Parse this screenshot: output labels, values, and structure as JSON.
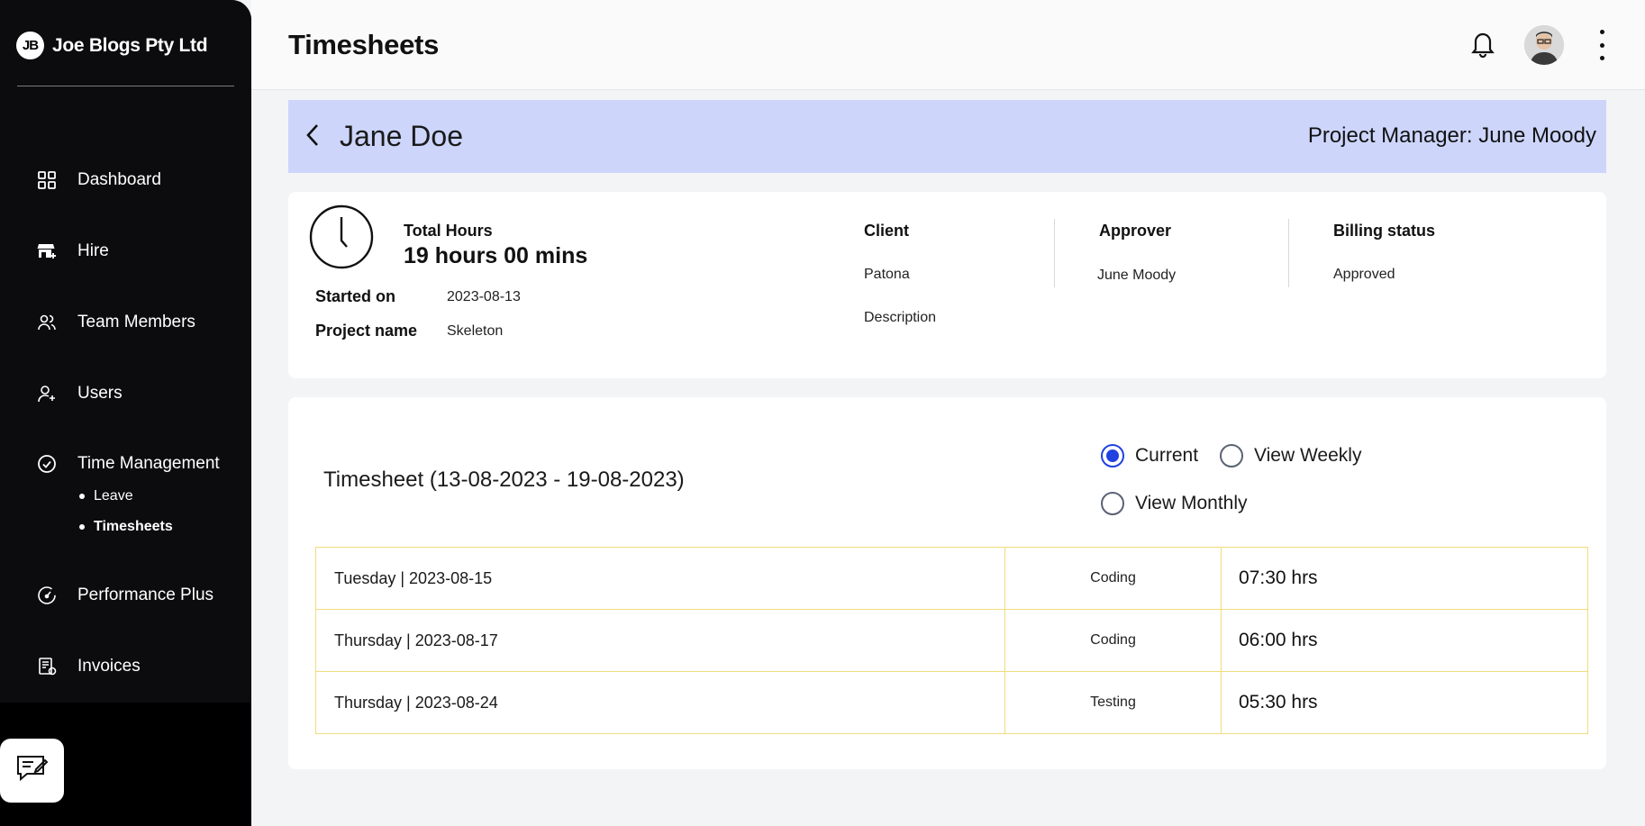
{
  "brand": {
    "logo": "JB",
    "name": "Joe Blogs Pty Ltd"
  },
  "sidebar": {
    "items": [
      {
        "label": "Dashboard",
        "icon": "grid-icon"
      },
      {
        "label": "Hire",
        "icon": "store-icon"
      },
      {
        "label": "Team Members",
        "icon": "team-icon"
      },
      {
        "label": "Users",
        "icon": "user-add-icon"
      },
      {
        "label": "Time Management",
        "icon": "check-circle-icon"
      },
      {
        "label": "Performance Plus",
        "icon": "gauge-icon"
      },
      {
        "label": "Invoices",
        "icon": "receipt-icon"
      }
    ],
    "subitems": [
      {
        "label": "Leave",
        "active": false
      },
      {
        "label": "Timesheets",
        "active": true
      }
    ]
  },
  "header": {
    "title": "Timesheets"
  },
  "employee": {
    "name": "Jane Doe",
    "pm_label": "Project Manager:",
    "pm_name": "June Moody"
  },
  "summary": {
    "total_hours_label": "Total Hours",
    "total_hours_value": "19 hours 00 mins",
    "started_label": "Started on",
    "started_value": "2023-08-13",
    "project_label": "Project name",
    "project_value": "Skeleton",
    "client_label": "Client",
    "client_value": "Patona",
    "description_label": "Description",
    "approver_label": "Approver",
    "approver_value": "June Moody",
    "billing_label": "Billing status",
    "billing_value": "Approved"
  },
  "timesheet": {
    "title": "Timesheet (13-08-2023 - 19-08-2023)",
    "view_options": [
      {
        "label": "Current",
        "checked": true
      },
      {
        "label": "View Weekly",
        "checked": false
      },
      {
        "label": "View Monthly",
        "checked": false
      }
    ],
    "rows": [
      {
        "day": "Tuesday | 2023-08-15",
        "task": "Coding",
        "hours": "07:30 hrs"
      },
      {
        "day": "Thursday | 2023-08-17",
        "task": "Coding",
        "hours": "06:00 hrs"
      },
      {
        "day": "Thursday | 2023-08-24",
        "task": "Testing",
        "hours": "05:30 hrs"
      }
    ]
  },
  "colors": {
    "sidebar_bg": "#0c0c0e",
    "banner_bg": "#cdd5fb",
    "radio_accent": "#2042e0",
    "table_border": "#f1dc7c"
  }
}
